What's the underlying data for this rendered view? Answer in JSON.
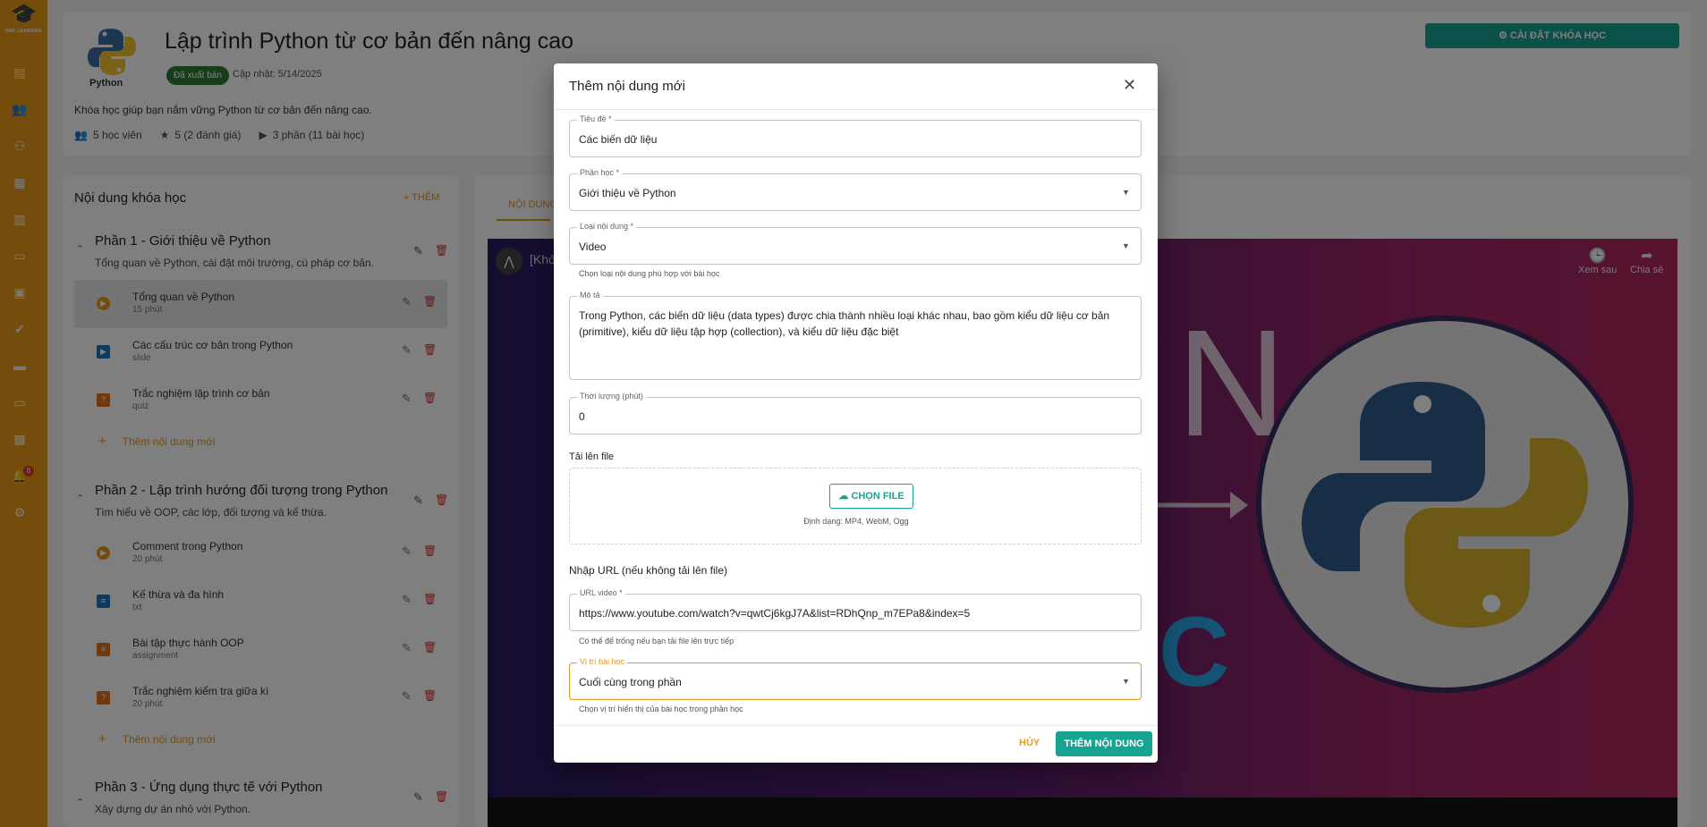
{
  "rail": {
    "brand": "DNC LEARNING",
    "notification_count": "8"
  },
  "header": {
    "logo_word": "Python",
    "title": "Lập trình Python từ cơ bản đến nâng cao",
    "status_badge": "Đã xuất bản",
    "updated": "Cập nhật: 5/14/2025",
    "description": "Khóa học giúp bạn nắm vững Python từ cơ bản đến nâng cao.",
    "students": "5 học viên",
    "rating": "5 (2 đánh giá)",
    "parts": "3 phần (11 bài học)",
    "settings_label": "CÀI ĐẶT KHÓA HỌC"
  },
  "content": {
    "title": "Nội dung khóa học",
    "add_label": "THÊM",
    "add_lesson_label": "Thêm nội dung mới",
    "sections": [
      {
        "title": "Phần 1 - Giới thiệu về Python",
        "desc": "Tổng quan về Python, cài đặt môi trường, cú pháp cơ bản.",
        "lessons": [
          {
            "name": "Tổng quan về Python",
            "sub": "15 phút"
          },
          {
            "name": "Các cấu trúc cơ bản trong Python",
            "sub": "slide"
          },
          {
            "name": "Trắc nghiệm lập trình cơ bản",
            "sub": "quiz"
          }
        ]
      },
      {
        "title": "Phần 2 - Lập trình hướng đối tượng trong Python",
        "desc": "Tìm hiểu về OOP, các lớp, đối tượng và kế thừa.",
        "lessons": [
          {
            "name": "Comment trong Python",
            "sub": "20 phút"
          },
          {
            "name": "Kế thừa và đa hình",
            "sub": "txt"
          },
          {
            "name": "Bài tập thực hành OOP",
            "sub": "assignment"
          },
          {
            "name": "Trắc nghiệm kiểm tra giữa kì",
            "sub": "20 phút"
          }
        ]
      },
      {
        "title": "Phần 3 - Ứng dụng thực tế với Python",
        "desc": "Xây dựng dự án nhỏ với Python."
      }
    ]
  },
  "right": {
    "tab_label": "NỘI DUNG",
    "video_title": "[Khó",
    "watch_later": "Xem sau",
    "share": "Chia sẻ",
    "video_letters_n": "N",
    "video_letters_c": "C"
  },
  "dialog": {
    "title": "Thêm nội dung mới",
    "title_field": {
      "label": "Tiêu đề *",
      "value": "Các biến dữ liệu"
    },
    "section_field": {
      "label": "Phần học *",
      "value": "Giới thiệu về Python"
    },
    "type_field": {
      "label": "Loại nội dung *",
      "value": "Video",
      "helper": "Chọn loại nội dung phù hợp với bài học"
    },
    "desc_field": {
      "label": "Mô tả",
      "value": "Trong Python, các biến dữ liệu (data types) được chia thành nhiều loại khác nhau, bao gồm kiểu dữ liệu cơ bản (primitive), kiểu dữ liệu tập hợp (collection), và kiểu dữ liệu đặc biệt"
    },
    "duration_field": {
      "label": "Thời lượng (phút)",
      "value": "0"
    },
    "upload_label": "Tải lên file",
    "upload_button": "CHỌN FILE",
    "upload_formats": "Định dạng: MP4, WebM, Ogg",
    "url_section_label": "Nhập URL (nếu không tải lên file)",
    "url_field": {
      "label": "URL video *",
      "value": "https://www.youtube.com/watch?v=qwtCj6kgJ7A&list=RDhQnp_m7EPa8&index=5",
      "helper": "Có thể để trống nếu bạn tải file lên trực tiếp"
    },
    "position_field": {
      "label": "Vị trí bài học",
      "value": "Cuối cùng trong phần",
      "helper": "Chọn vị trí hiển thị của bài học trong phần học"
    },
    "cancel_label": "HỦY",
    "submit_label": "THÊM NỘI DUNG"
  },
  "colors": {
    "accent": "#e99a1a",
    "teal": "#16a392",
    "danger": "#d32f2f",
    "published": "#2e7d32"
  }
}
